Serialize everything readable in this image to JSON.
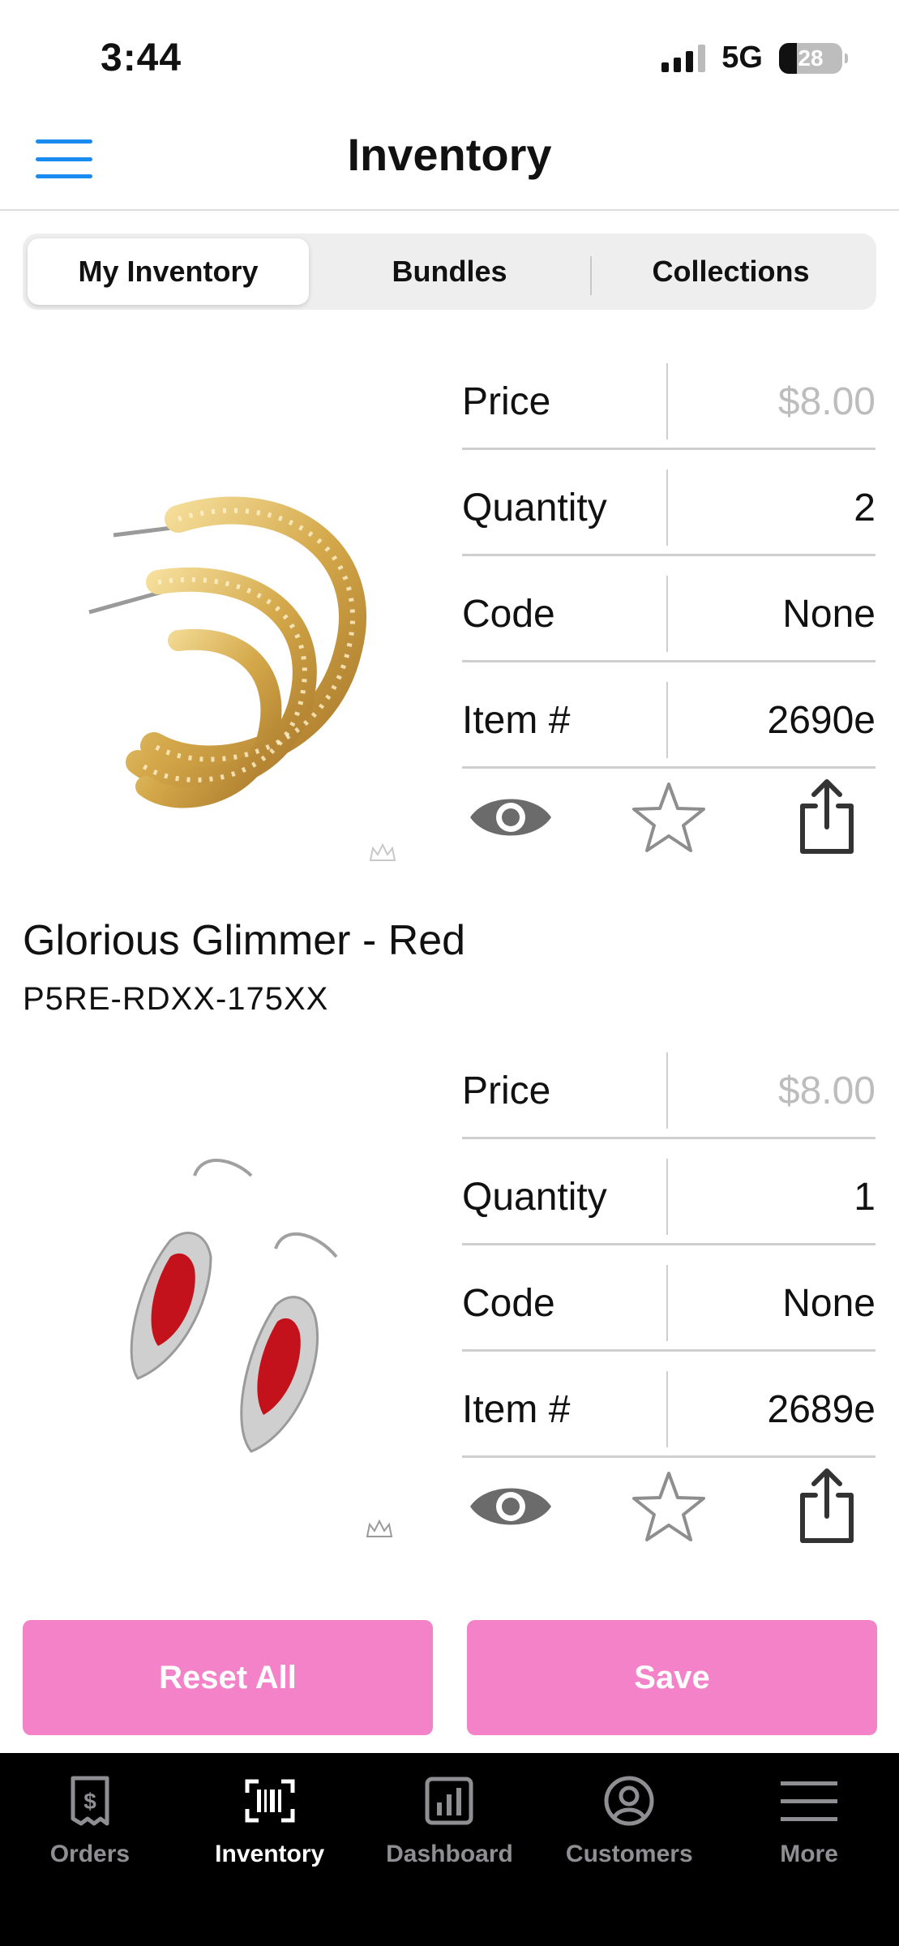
{
  "status": {
    "time": "3:44",
    "network": "5G",
    "battery": "28",
    "battery_level": 0.28
  },
  "nav": {
    "title": "Inventory",
    "menu_icon": "hamburger-icon"
  },
  "segments": [
    {
      "label": "My Inventory",
      "active": true
    },
    {
      "label": "Bundles",
      "active": false
    },
    {
      "label": "Collections",
      "active": false
    }
  ],
  "products": [
    {
      "image_icon": "gold-hoop-earrings-image",
      "title": "",
      "sku": "",
      "fields": [
        {
          "label": "Price",
          "value": "$8.00"
        },
        {
          "label": "Quantity",
          "value": "2"
        },
        {
          "label": "Code",
          "value": "None"
        },
        {
          "label": "Item #",
          "value": "2690e"
        }
      ]
    },
    {
      "image_icon": "red-drop-earrings-image",
      "title": "Glorious Glimmer - Red",
      "sku": "P5RE-RDXX-175XX",
      "fields": [
        {
          "label": "Price",
          "value": "$8.00"
        },
        {
          "label": "Quantity",
          "value": "1"
        },
        {
          "label": "Code",
          "value": "None"
        },
        {
          "label": "Item #",
          "value": "2689e"
        }
      ]
    }
  ],
  "actions": {
    "eye_icon": "eye-icon",
    "star_icon": "star-icon",
    "share_icon": "share-icon"
  },
  "buttons": {
    "reset": "Reset All",
    "save": "Save"
  },
  "tabbar": [
    {
      "label": "Orders",
      "icon": "receipt-dollar-icon",
      "active": false
    },
    {
      "label": "Inventory",
      "icon": "barcode-scan-icon",
      "active": true
    },
    {
      "label": "Dashboard",
      "icon": "bar-chart-icon",
      "active": false
    },
    {
      "label": "Customers",
      "icon": "person-circle-icon",
      "active": false
    },
    {
      "label": "More",
      "icon": "hamburger-icon",
      "active": false
    }
  ],
  "colors": {
    "accent_blue": "#1a8cf0",
    "button_pink": "#f482c8",
    "muted": "#bdbdbd"
  }
}
